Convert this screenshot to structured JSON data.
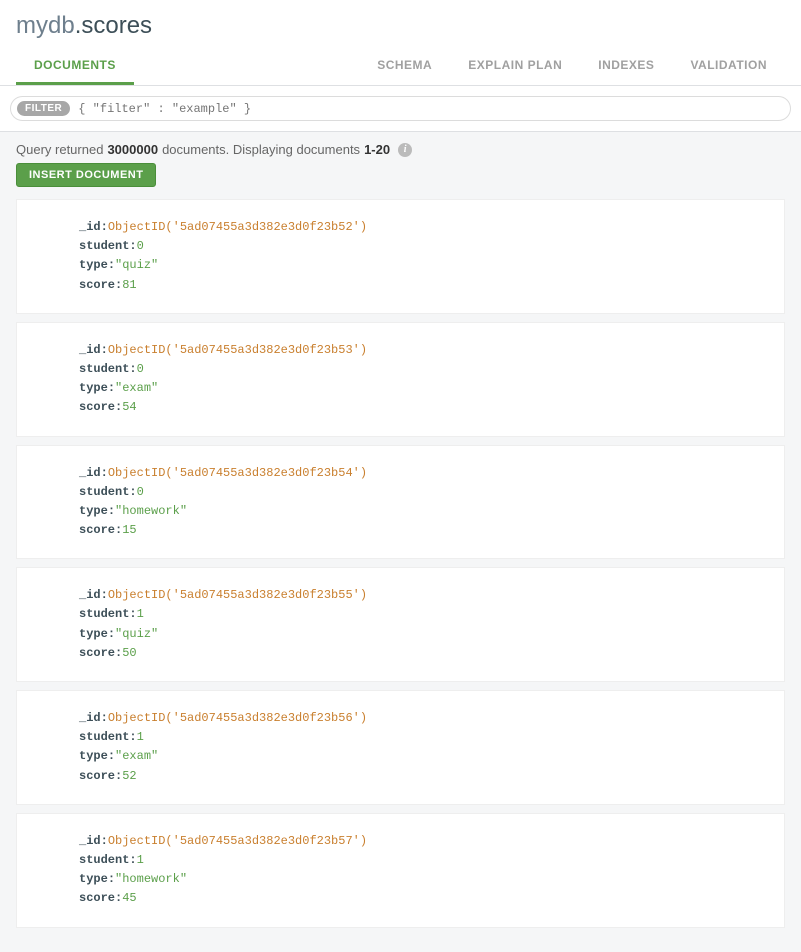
{
  "namespace": {
    "db": "mydb",
    "coll": ".scores"
  },
  "tabs": [
    {
      "label": "DOCUMENTS",
      "active": true
    },
    {
      "label": "SCHEMA"
    },
    {
      "label": "EXPLAIN PLAN"
    },
    {
      "label": "INDEXES"
    },
    {
      "label": "VALIDATION"
    }
  ],
  "filter": {
    "badge": "FILTER",
    "placeholder": "{ \"filter\" : \"example\" }"
  },
  "result": {
    "prefix": "Query returned ",
    "count": "3000000",
    "mid": " documents. Displaying documents ",
    "range": "1-20"
  },
  "insert_label": "INSERT DOCUMENT",
  "documents": [
    {
      "_id": "ObjectID('5ad07455a3d382e3d0f23b52')",
      "student": "0",
      "type": "\"quiz\"",
      "score": "81"
    },
    {
      "_id": "ObjectID('5ad07455a3d382e3d0f23b53')",
      "student": "0",
      "type": "\"exam\"",
      "score": "54"
    },
    {
      "_id": "ObjectID('5ad07455a3d382e3d0f23b54')",
      "student": "0",
      "type": "\"homework\"",
      "score": "15"
    },
    {
      "_id": "ObjectID('5ad07455a3d382e3d0f23b55')",
      "student": "1",
      "type": "\"quiz\"",
      "score": "50"
    },
    {
      "_id": "ObjectID('5ad07455a3d382e3d0f23b56')",
      "student": "1",
      "type": "\"exam\"",
      "score": "52"
    },
    {
      "_id": "ObjectID('5ad07455a3d382e3d0f23b57')",
      "student": "1",
      "type": "\"homework\"",
      "score": "45"
    }
  ],
  "field_keys": {
    "_id": "_id",
    "student": "student",
    "type": "type",
    "score": "score"
  }
}
